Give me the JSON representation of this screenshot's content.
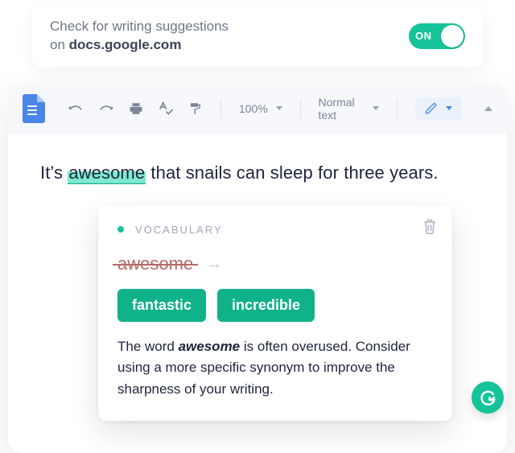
{
  "extension": {
    "line1": "Check for writing suggestions",
    "line2_prefix": "on ",
    "domain": "docs.google.com",
    "toggle_label": "ON"
  },
  "toolbar": {
    "zoom": "100%",
    "style": "Normal text"
  },
  "document": {
    "sentence_before": "It’s ",
    "highlight": "awesome",
    "sentence_after": " that snails can sleep for three years."
  },
  "suggestion": {
    "category": "VOCABULARY",
    "original": "awesome",
    "replacements": [
      "fantastic",
      "incredible"
    ],
    "explanation_pre": "The word ",
    "explanation_word": "awesome",
    "explanation_post": " is often overused. Consider using a more specific synonym to improve the sharpness of your writing."
  }
}
